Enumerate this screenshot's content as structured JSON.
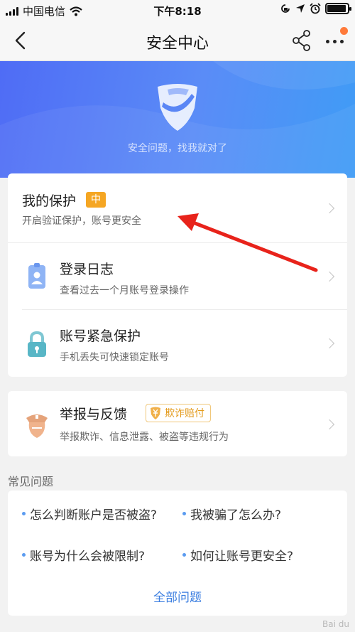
{
  "status_bar": {
    "carrier": "中国电信",
    "time": "下午8:18",
    "battery_level": 0.85
  },
  "nav": {
    "title": "安全中心"
  },
  "hero": {
    "slogan": "安全问题，找我就对了"
  },
  "protection": {
    "title": "我的保护",
    "level_badge": "中",
    "subtitle": "开启验证保护，账号更安全"
  },
  "login_log": {
    "title": "登录日志",
    "subtitle": "查看过去一个月账号登录操作"
  },
  "emergency": {
    "title": "账号紧急保护",
    "subtitle": "手机丢失可快速锁定账号"
  },
  "report": {
    "title": "举报与反馈",
    "badge": "欺诈赔付",
    "subtitle": "举报欺诈、信息泄露、被盗等违规行为"
  },
  "faq": {
    "heading": "常见问题",
    "items": [
      "怎么判断账户是否被盗?",
      "我被骗了怎么办?",
      "账号为什么会被限制?",
      "如何让账号更安全?"
    ],
    "all_label": "全部问题"
  },
  "colors": {
    "accent": "#4f6cf5",
    "badge_orange": "#f5a623",
    "link_blue": "#3b7ee0",
    "annotation_red": "#e8231b"
  },
  "icons": [
    "wifi-icon",
    "lock-rotation-icon",
    "location-icon",
    "alarm-icon",
    "back-icon",
    "share-icon",
    "more-icon",
    "shield-icon",
    "badge-card-icon",
    "padlock-icon",
    "police-icon",
    "yen-shield-icon"
  ]
}
